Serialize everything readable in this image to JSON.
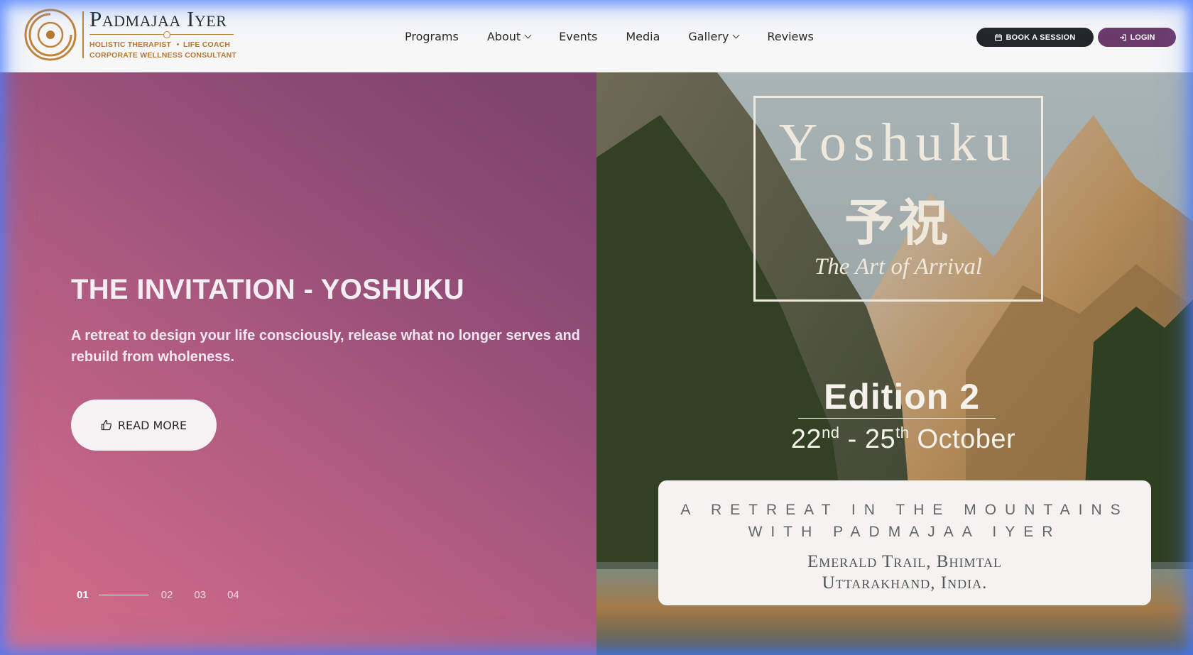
{
  "brand": {
    "name": "Padmajaa Iyer",
    "tagline_1a": "HOLISTIC THERAPIST",
    "tagline_1b": "LIFE COACH",
    "tagline_2": "CORPORATE WELLNESS  CONSULTANT",
    "color": "#b9772e"
  },
  "nav": {
    "items": [
      "Programs",
      "About",
      "Events",
      "Media",
      "Gallery",
      "Reviews"
    ]
  },
  "actions": {
    "book_label": "BOOK A SESSION",
    "login_label": "LOGIN"
  },
  "hero": {
    "title": "THE INVITATION - YOSHUKU",
    "subtitle": "A retreat to design your life consciously, release what no longer serves and rebuild from wholeness.",
    "cta_label": "READ MORE",
    "pager": [
      "01",
      "02",
      "03",
      "04"
    ],
    "active_slide": "01"
  },
  "poster": {
    "word": "Yoshuku",
    "kanji": "予祝",
    "tagline": "The Art of Arrival",
    "edition": "Edition 2",
    "date_start": "22",
    "date_start_sup": "nd",
    "date_sep": " - ",
    "date_end": "25",
    "date_end_sup": "th",
    "date_month": " October",
    "retreat_line": "A RETREAT IN THE MOUNTAINS WITH PADMAJAA IYER",
    "location_1": "Emerald Trail, Bhimtal",
    "location_2": "Uttarakhand, India."
  },
  "colors": {
    "book_button": "#23272b",
    "login_button": "#6b3a6a",
    "hero_gradient_start": "#d56d8a",
    "hero_gradient_end": "#7a426c"
  }
}
